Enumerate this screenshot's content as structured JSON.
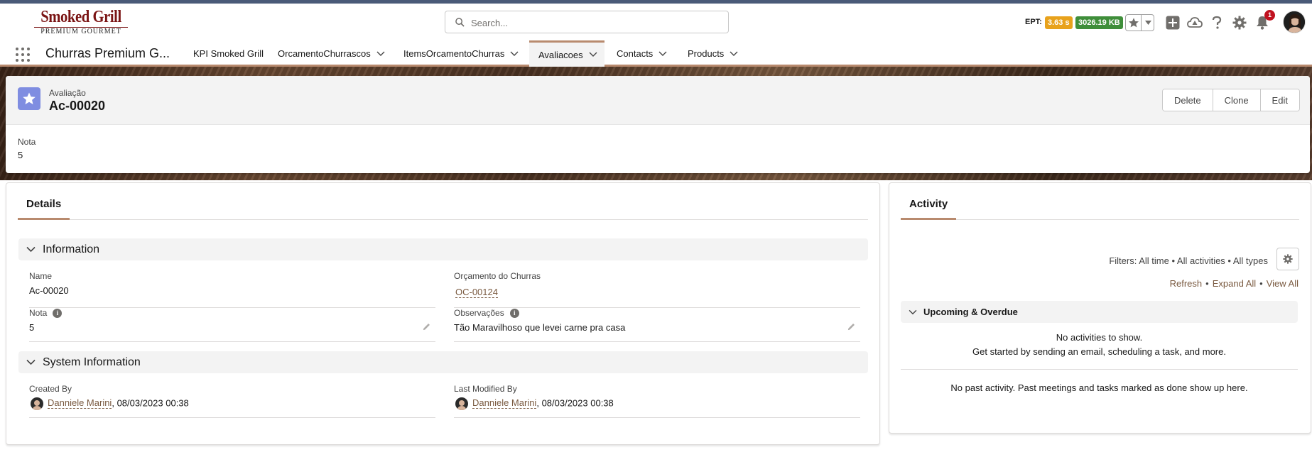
{
  "header": {
    "logo_main": "Smoked Grill",
    "logo_sub": "PREMIUM GOURMET",
    "search_placeholder": "Search...",
    "ept_label": "EPT:",
    "ept_value": "3.63 s",
    "kb_value": "3026.19 KB",
    "notification_count": "1",
    "icons": [
      "favorites-star-icon",
      "chevron-down-icon",
      "add-icon",
      "trailhead-icon",
      "help-icon",
      "setup-gear-icon",
      "notification-bell-icon"
    ],
    "colors": {
      "ept_badge": "#e8a21c",
      "kb_badge": "#3f8e3a",
      "notification": "#c0111f"
    }
  },
  "nav": {
    "app_name": "Churras Premium G...",
    "items": [
      {
        "label": "KPI Smoked Grill",
        "has_menu": false
      },
      {
        "label": "OrcamentoChurrascos",
        "has_menu": true
      },
      {
        "label": "ItemsOrcamentoChurras",
        "has_menu": true
      },
      {
        "label": "Avaliacoes",
        "has_menu": true,
        "active": true
      },
      {
        "label": "Contacts",
        "has_menu": true
      },
      {
        "label": "Products",
        "has_menu": true
      }
    ],
    "accent_color": "#b88a6e"
  },
  "record": {
    "object_type": "Avaliação",
    "title": "Ac-00020",
    "icon": "star-icon",
    "icon_color": "#7f8de1",
    "actions": [
      "Delete",
      "Clone",
      "Edit"
    ],
    "highlight_field": {
      "label": "Nota",
      "value": "5"
    }
  },
  "details": {
    "tab": "Details",
    "sections": [
      {
        "title": "Information",
        "fields": [
          {
            "label": "Name",
            "value": "Ac-00020"
          },
          {
            "label": "Orçamento do Churras",
            "value": "OC-00124",
            "link": true
          },
          {
            "label": "Nota",
            "value": "5",
            "info": true,
            "editable": true
          },
          {
            "label": "Observações",
            "value": "Tão Maravilhoso que levei carne pra casa",
            "info": true,
            "editable": true
          }
        ]
      },
      {
        "title": "System Information",
        "fields": [
          {
            "label": "Created By",
            "user": "Danniele Marini",
            "date": "08/03/2023 00:38"
          },
          {
            "label": "Last Modified By",
            "user": "Danniele Marini",
            "date": "08/03/2023 00:38"
          }
        ]
      }
    ]
  },
  "activity": {
    "tab": "Activity",
    "filters": "Filters: All time • All activities • All types",
    "links": [
      "Refresh",
      "Expand All",
      "View All"
    ],
    "upcoming_title": "Upcoming & Overdue",
    "no_activities": "No activities to show.",
    "get_started": "Get started by sending an email, scheduling a task, and more.",
    "no_past": "No past activity. Past meetings and tasks marked as done show up here."
  }
}
